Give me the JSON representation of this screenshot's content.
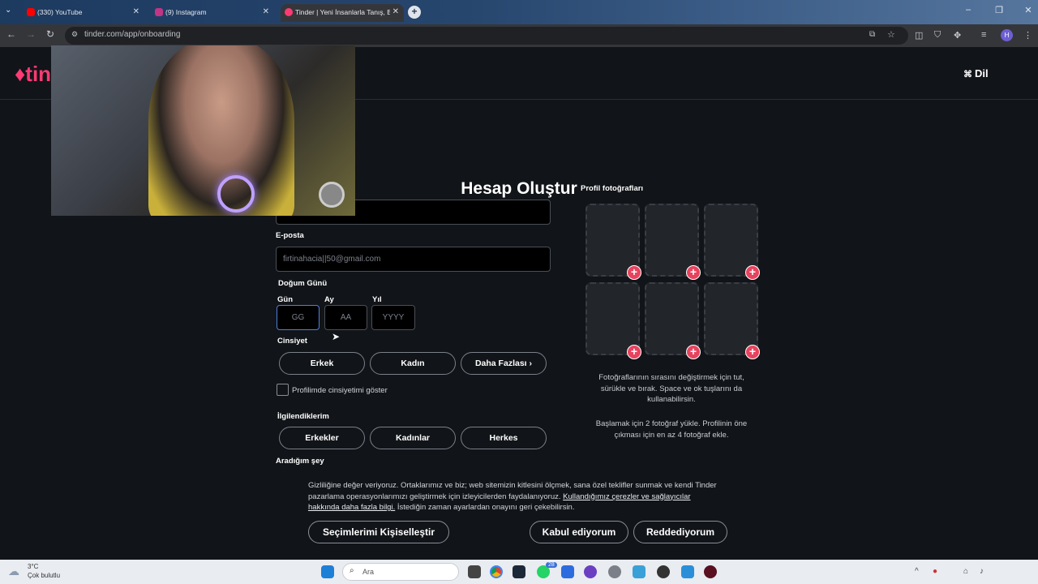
{
  "browser": {
    "tabs": [
      {
        "label": "(330) YouTube",
        "color": "#ff0000"
      },
      {
        "label": "(9) Instagram",
        "color": "#c13584"
      },
      {
        "label": "Tinder | Yeni İnsanlarla Tanış, Bi",
        "color": "#fd3a73"
      }
    ],
    "new_tab": "+",
    "url": "tinder.com/app/onboarding",
    "profile_initial": "H"
  },
  "header": {
    "logo_text": "tin",
    "language_label": "Dil"
  },
  "form": {
    "title": "Hesap Oluştur",
    "email_label": "E-posta",
    "email_value": "firtinahacia||50@gmail.com",
    "birthday_label": "Doğum Günü",
    "day_label": "Gün",
    "day_placeholder": "GG",
    "month_label": "Ay",
    "month_placeholder": "AA",
    "year_label": "Yıl",
    "year_placeholder": "YYYY",
    "gender_label": "Cinsiyet",
    "gender_options": [
      "Erkek",
      "Kadın",
      "Daha Fazlası"
    ],
    "show_gender_label": "Profilimde cinsiyetimi göster",
    "interest_label": "İlgilendiklerim",
    "interest_options": [
      "Erkekler",
      "Kadınlar",
      "Herkes"
    ],
    "looking_for_label": "Aradığım şey"
  },
  "photos": {
    "label": "Profil fotoğrafları",
    "help1": "Fotoğraflarının sırasını değiştirmek için tut, sürükle ve bırak. Space ve ok tuşlarını da kullanabilirsin.",
    "help2": "Başlamak için 2 fotoğraf yükle. Profilinin öne çıkması için en az 4 fotoğraf ekle."
  },
  "consent": {
    "text_before": "Gizliliğine değer veriyoruz. Ortaklarımız ve biz; web sitemizin kitlesini ölçmek, sana özel teklifler sunmak ve kendi Tinder pazarlama operasyonlarımızı geliştirmek için izleyicilerden faydalanıyoruz.",
    "link": "Kullandığımız çerezler ve sağlayıcılar hakkında daha fazla bilgi.",
    "text_after": "İstediğin zaman ayarlardan onayını geri çekebilirsin.",
    "customize_label": "Seçimlerimi Kişiselleştir",
    "accept_label": "Kabul ediyorum",
    "reject_label": "Reddediyorum"
  },
  "taskbar": {
    "weather_temp": "3°C",
    "weather_desc": "Çok bulutlu",
    "search_label": "Ara",
    "badge": "28"
  },
  "colors": {
    "brand": "#fd3a73",
    "add_button": "#e8435e",
    "page_bg": "#111418"
  }
}
